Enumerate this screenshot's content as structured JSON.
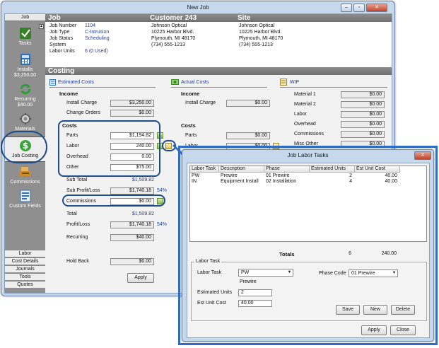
{
  "window": {
    "title": "New Job"
  },
  "sidebar": {
    "header": "Job",
    "items": [
      {
        "label": "Tasks"
      },
      {
        "label": "Installs",
        "sub": "$3,250.00"
      },
      {
        "label": "Recurring",
        "sub": "$40.00"
      },
      {
        "label": "Materials"
      },
      {
        "label": "Job Costing"
      },
      {
        "label": "Commissions"
      },
      {
        "label": "Custom Fields"
      }
    ],
    "tabs": [
      "Labor",
      "Cost Details",
      "Journals",
      "Tools",
      "Quotes"
    ]
  },
  "header": {
    "job_title": "Job",
    "customer_title": "Customer 243",
    "site_title": "Site",
    "job_fields": [
      {
        "label": "Job Number",
        "value": "1104"
      },
      {
        "label": "Job Type",
        "value": "C-Intrusion"
      },
      {
        "label": "Job Status",
        "value": "Scheduling"
      },
      {
        "label": "System",
        "value": ""
      },
      {
        "label": "Labor Units",
        "value": "6 (0 Used)"
      }
    ],
    "customer": {
      "name": "Johnson Optical",
      "address": "10225 Harbor Blvd.",
      "city": "Plymouth, MI 48170",
      "phone": "(734) 555-1213"
    },
    "site": {
      "name": "Johnson Optical",
      "address": "10225 Harbor Blvd.",
      "city": "Plymouth, MI 48170",
      "phone": "(734) 555-1213"
    }
  },
  "costing": {
    "title": "Costing",
    "estimated": {
      "title": "Estimated Costs",
      "income": "Income",
      "install_charge_label": "Install Charge",
      "install_charge": "$3,250.00",
      "change_orders_label": "Change Orders",
      "change_orders": "$0.00",
      "costs": "Costs",
      "parts_label": "Parts",
      "parts": "$1,194.82",
      "labor_label": "Labor",
      "labor": "240.00",
      "overhead_label": "Overhead",
      "overhead": "0.00",
      "other_label": "Other",
      "other": "$75.00",
      "subtotal_label": "Sub Total",
      "subtotal": "$1,509.82",
      "sub_profit_label": "Sub Profit/Loss",
      "sub_profit": "$1,740.18",
      "sub_profit_pct": "54%",
      "commissions_label": "Commissions",
      "commissions": "$0.00",
      "total_label": "Total",
      "total": "$1,509.82",
      "profit_label": "Profit/Loss",
      "profit": "$1,740.18",
      "profit_pct": "54%",
      "recurring_label": "Recurring",
      "recurring": "$40.00",
      "holdback_label": "Hold Back",
      "holdback": "$0.00",
      "apply": "Apply"
    },
    "actual": {
      "title": "Actual Costs",
      "income": "Income",
      "install_charge_label": "Install Charge",
      "install_charge": "$0.00",
      "costs": "Costs",
      "parts_label": "Parts",
      "parts": "$0.00",
      "labor_label": "Labor",
      "labor": "$0.00"
    },
    "wip": {
      "title": "WIP",
      "rows": [
        {
          "label": "Material 1",
          "value": "$0.00"
        },
        {
          "label": "Material 2",
          "value": "$0.00"
        },
        {
          "label": "Labor",
          "value": "$0.00"
        },
        {
          "label": "Overhead",
          "value": "$0.00"
        },
        {
          "label": "Commissions",
          "value": "$0.00"
        },
        {
          "label": "Misc Other",
          "value": "$0.00"
        }
      ]
    }
  },
  "dialog": {
    "title": "Job Labor Tasks",
    "columns": [
      "Labor Task",
      "Description",
      "Phase",
      "Estimated Units",
      "Est Unit Cost"
    ],
    "rows": [
      {
        "task": "PW",
        "description": "Prewire",
        "phase": "01 Prewire",
        "units": "2",
        "cost": "40.00"
      },
      {
        "task": "IN",
        "description": "Equipment Install",
        "phase": "02 Installation",
        "units": "4",
        "cost": "40.00"
      }
    ],
    "totals_label": "Totals",
    "totals_units": "6",
    "totals_cost": "240.00",
    "group_title": "Labor Task",
    "labor_task_label": "Labor Task",
    "labor_task_value": "PW",
    "labor_task_desc": "Prewire",
    "phase_code_label": "Phase Code",
    "phase_code_value": "01 Prewire",
    "est_units_label": "Estimated Units",
    "est_units_value": "2",
    "est_cost_label": "Est Unit Cost",
    "est_cost_value": "40.00",
    "save": "Save",
    "new": "New",
    "delete": "Delete",
    "apply": "Apply",
    "close": "Close"
  }
}
